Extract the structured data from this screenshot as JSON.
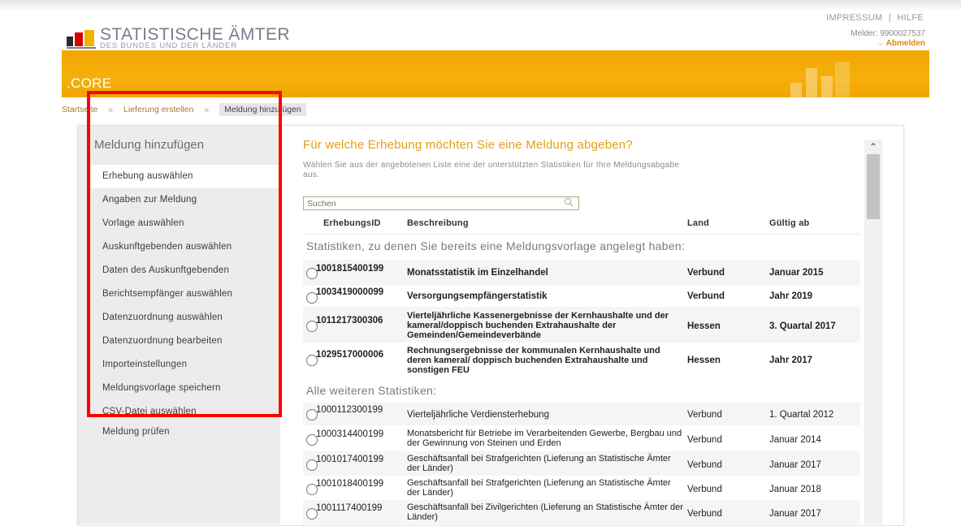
{
  "header": {
    "links": [
      "IMPRESSUM",
      "HILFE"
    ],
    "link_separator": "|",
    "melder_label": "Melder: 9900027537",
    "logout_label": "→ Abmelden",
    "logo_title": "STATISTISCHE ÄMTER",
    "logo_subtitle": "DES BUNDES UND DER LÄNDER",
    "app_name": ".CORE"
  },
  "breadcrumb": {
    "items": [
      "Startseite",
      "Lieferung erstellen",
      "Meldung hinzufügen"
    ],
    "separator": "»"
  },
  "sidebar": {
    "title": "Meldung hinzufügen",
    "items": [
      {
        "label": "Erhebung auswählen",
        "active": true
      },
      {
        "label": "Angaben zur Meldung"
      },
      {
        "label": "Vorlage auswählen"
      },
      {
        "label": "Auskunftgebenden auswählen"
      },
      {
        "label": "Daten des Auskunftgebenden"
      },
      {
        "label": "Berichtsempfänger auswählen"
      },
      {
        "label": "Datenzuordnung auswählen"
      },
      {
        "label": "Datenzuordnung bearbeiten"
      },
      {
        "label": "Importeinstellungen"
      },
      {
        "label": "Meldungsvorlage speichern"
      },
      {
        "label": "CSV-Datei auswählen"
      },
      {
        "label": "Meldung prüfen"
      }
    ]
  },
  "main": {
    "heading": "Für welche Erhebung möchten Sie eine Meldung abgeben?",
    "description": "Wählen Sie aus der angebotenen Liste eine der unterstützten Statistiken für Ihre Meldungsabgabe aus.",
    "search_placeholder": "Suchen",
    "columns": [
      "ErhebungsID",
      "Beschreibung",
      "Land",
      "Gültig ab"
    ],
    "section_existing": "Statistiken, zu denen Sie bereits eine Meldungsvorlage angelegt haben:",
    "section_other": "Alle weiteren Statistiken:",
    "existing_rows": [
      {
        "id": "1001815400199",
        "desc": "Monatsstatistik im Einzelhandel",
        "land": "Verbund",
        "date": "Januar 2015"
      },
      {
        "id": "1003419000099",
        "desc": "Versorgungsempfängerstatistik",
        "land": "Verbund",
        "date": "Jahr 2019"
      },
      {
        "id": "1011217300306",
        "desc": "Vierteljährliche Kassenergebnisse der Kernhaushalte und der kameral/doppisch buchenden Extrahaushalte der Gemeinden/Gemeindeverbände",
        "land": "Hessen",
        "date": "3. Quartal 2017"
      },
      {
        "id": "1029517000006",
        "desc": "Rechnungsergebnisse der kommunalen Kernhaushalte und deren kameral/ doppisch buchenden Extrahaushalte und sonstigen FEU",
        "land": "Hessen",
        "date": "Jahr 2017"
      }
    ],
    "other_rows": [
      {
        "id": "1000112300199",
        "desc": "Vierteljährliche Verdiensterhebung",
        "land": "Verbund",
        "date": "1. Quartal 2012"
      },
      {
        "id": "1000314400199",
        "desc": "Monatsbericht für Betriebe im Verarbeitenden Gewerbe, Bergbau und der Gewinnung von Steinen und Erden",
        "land": "Verbund",
        "date": "Januar 2014"
      },
      {
        "id": "1001017400199",
        "desc": "Geschäftsanfall bei Strafgerichten (Lieferung an Statistische Ämter der Länder)",
        "land": "Verbund",
        "date": "Januar 2017"
      },
      {
        "id": "1001018400199",
        "desc": "Geschäftsanfall bei Strafgerichten (Lieferung an Statistische Ämter der Länder)",
        "land": "Verbund",
        "date": "Januar 2018"
      },
      {
        "id": "1001117400199",
        "desc": "Geschäftsanfall bei Zivilgerichten (Lieferung an Statistische Ämter der Länder)",
        "land": "Verbund",
        "date": "Januar 2017"
      }
    ]
  },
  "colors": {
    "brand_orange": "#f3a400",
    "highlight": "#ff0000",
    "heading_orange": "#e0a015"
  }
}
